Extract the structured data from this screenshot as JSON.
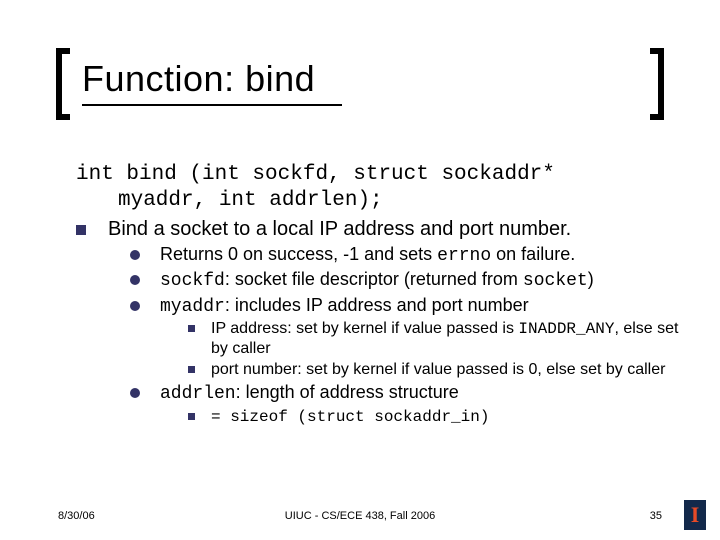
{
  "title": "Function: bind",
  "signature": {
    "line1": "int bind (int sockfd, struct sockaddr*",
    "line2": "myaddr, int addrlen);"
  },
  "bind_desc": "Bind a socket to a local IP address and port number.",
  "sub": {
    "returns_a": "Returns 0 on success, -1 and sets ",
    "returns_code": "errno",
    "returns_b": " on failure.",
    "sockfd_code": "sockfd",
    "sockfd_text": ": socket file descriptor (returned from ",
    "sockfd_code2": "socket",
    "sockfd_tail": ")",
    "myaddr_code": "myaddr",
    "myaddr_text": ": includes IP address and port number",
    "ip_a": "IP address: set by kernel if value passed is ",
    "ip_code": "INADDR_ANY",
    "ip_b": ", else set by caller",
    "port": "port number: set by kernel if value passed is 0, else set by caller",
    "addrlen_code": "addrlen",
    "addrlen_text": ": length of address structure",
    "sizeof": "= sizeof (struct sockaddr_in)"
  },
  "footer": {
    "date": "8/30/06",
    "center": "UIUC - CS/ECE 438, Fall 2006",
    "page": "35"
  }
}
